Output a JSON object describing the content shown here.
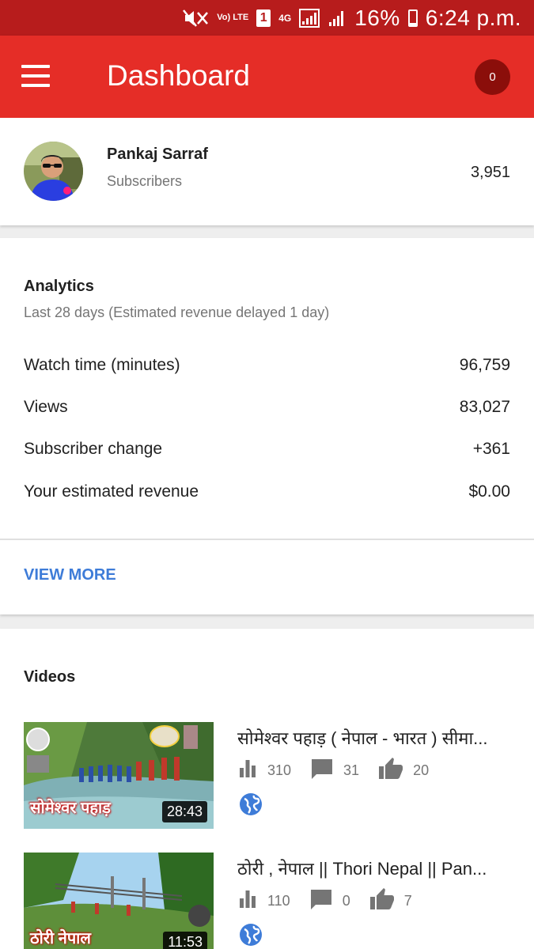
{
  "status_bar": {
    "battery": "16%",
    "time": "6:24 p.m.",
    "network_label": "Vo) LTE",
    "sim": "1",
    "data_type": "4G",
    "battery_level": 0.16
  },
  "app_bar": {
    "title": "Dashboard",
    "notification_count": "0"
  },
  "channel": {
    "name": "Pankaj Sarraf",
    "subtitle": "Subscribers",
    "subscriber_count": "3,951"
  },
  "analytics": {
    "title": "Analytics",
    "subtitle": "Last 28 days (Estimated revenue delayed 1 day)",
    "metrics": [
      {
        "label": "Watch time (minutes)",
        "value": "96,759"
      },
      {
        "label": "Views",
        "value": "83,027"
      },
      {
        "label": "Subscriber change",
        "value": "+361"
      },
      {
        "label": "Your estimated revenue",
        "value": "$0.00"
      }
    ],
    "view_more_label": "VIEW MORE"
  },
  "videos": {
    "title": "Videos",
    "items": [
      {
        "title": "सोमेश्वर पहाड़ ( नेपाल - भारत ) सीमा...",
        "views": "310",
        "comments": "31",
        "likes": "20",
        "duration": "28:43",
        "thumb_text": "सोमेश्वर पहाड़"
      },
      {
        "title": "ठोरी , नेपाल || Thori Nepal  || Pan...",
        "views": "110",
        "comments": "0",
        "likes": "7",
        "duration": "11:53",
        "thumb_text": "ठोरी नेपाल"
      }
    ]
  },
  "colors": {
    "status_bar": "#b71c1c",
    "app_bar": "#e52d27",
    "badge": "#8b0e0a",
    "link": "#3e7cd8",
    "globe": "#3e7cd8"
  },
  "icons": [
    "hamburger-menu-icon",
    "bar-chart-icon",
    "comment-icon",
    "thumbs-up-icon",
    "globe-icon",
    "mute-icon",
    "signal-icon",
    "battery-icon"
  ]
}
